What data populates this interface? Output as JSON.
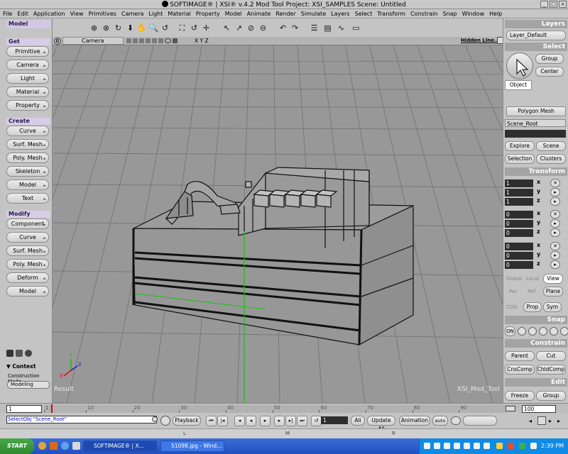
{
  "window": {
    "title": "SOFTIMAGE® | XSI® v.4.2 Mod Tool Project: XSI_SAMPLES     Scene: Untitled",
    "controls": [
      "_",
      "□",
      "×"
    ]
  },
  "menu": [
    "File",
    "Edit",
    "Application",
    "View",
    "Primitives",
    "Camera",
    "Light",
    "Material",
    "Property",
    "Model",
    "Animate",
    "Render",
    "Simulate",
    "Layers",
    "Select",
    "Transform",
    "Constrain",
    "Snap",
    "Window",
    "Help"
  ],
  "toolbar_icons": [
    "sniper-icon",
    "sniper-alt-icon",
    "rotate-orbit-icon",
    "dolly-down-icon",
    "hand-pan-icon",
    "zoom-icon",
    "roll-icon",
    "frame-icon",
    "reset-view-icon",
    "move-cross-icon",
    "select-arrow-icon",
    "raycast-select-icon",
    "tag-select-icon",
    "rectangle-select-icon",
    "undo-icon",
    "redo-icon",
    "explorer-icon",
    "schematic-icon",
    "fcurve-icon",
    "render-region-icon"
  ],
  "left": {
    "tab": "Model",
    "get_header": "Get",
    "get_items": [
      "Primitive",
      "Camera",
      "Light",
      "Material",
      "Property"
    ],
    "create_header": "Create",
    "create_items": [
      "Curve",
      "Surf. Mesh",
      "Poly. Mesh",
      "Skeleton",
      "Model",
      "Text"
    ],
    "modify_header": "Modify",
    "modify_items": [
      "Component",
      "Curve",
      "Surf. Mesh",
      "Poly. Mesh",
      "Deform",
      "Model"
    ],
    "context_label": "▼ Context",
    "construction_mode_label": "Construction Mode",
    "construction_mode_value": "Modeling"
  },
  "viewport": {
    "letter": "B",
    "camera": "Camera",
    "axes": "X Y Z",
    "display_mode": "Hidden Line...",
    "result_label": "Result",
    "watermark": "XSI_Mod_Tool",
    "grid_color": "#787878",
    "wire_color": "#111111",
    "axis_green": "#12c412",
    "axis_red": "#e01010",
    "axis_blue": "#1a1ad8",
    "origin_x_label": "X",
    "origin_y_label": "Y",
    "origin_z_label": "Z"
  },
  "right": {
    "layers_header": "Layers",
    "layer_default": "Layer_Default",
    "select_header": "Select",
    "group_btn": "Group",
    "center_btn": "Center",
    "object_btn": "Object",
    "filter_btn": "Polygon Mesh",
    "scene_root_field": "Scene_Root",
    "explore_btn": "Explore",
    "scene_btn": "Scene",
    "selection_btn": "Selection",
    "clusters_btn": "Clusters",
    "transform_header": "Transform",
    "scale": [
      "1",
      "1",
      "1"
    ],
    "rotate": [
      "0",
      "0",
      "0"
    ],
    "translate": [
      "0",
      "0",
      "0"
    ],
    "axis_x": "x",
    "axis_y": "y",
    "axis_z": "z",
    "global_label": "Global",
    "local_label": "Local",
    "view_btn": "View",
    "par_label": "Par",
    "ref_label": "Ref",
    "plane_btn": "Plane",
    "cog_label": "COG",
    "prop_btn": "Prop",
    "sym_btn": "Sym",
    "snap_header": "Snap",
    "snap_on": "ON",
    "constrain_header": "Constrain",
    "parent_btn": "Parent",
    "cut_btn": "Cut",
    "cnscomp_btn": "CnsComp",
    "chldcomp_btn": "ChldComp",
    "edit_header": "Edit",
    "freeze_btn": "Freeze",
    "group_edit_btn": "Group"
  },
  "timeline": {
    "start": "1",
    "end": "100",
    "ticks": [
      "1",
      "10",
      "20",
      "30",
      "40",
      "50",
      "60",
      "70",
      "80",
      "90"
    ]
  },
  "transport": {
    "command": "SelectObj \"Scene_Root\"",
    "playback": "Playback",
    "frame": "1",
    "all": "All",
    "update_all": "Update All",
    "animation": "Animation",
    "auto": "auto",
    "mouse_l": "L",
    "mouse_m": "M",
    "mouse_r": "R"
  },
  "taskbar": {
    "start": "START",
    "items": [
      "SOFTIMAGE® | X...",
      "51098.jpg - Wind..."
    ],
    "clock": "2:39 PM"
  }
}
